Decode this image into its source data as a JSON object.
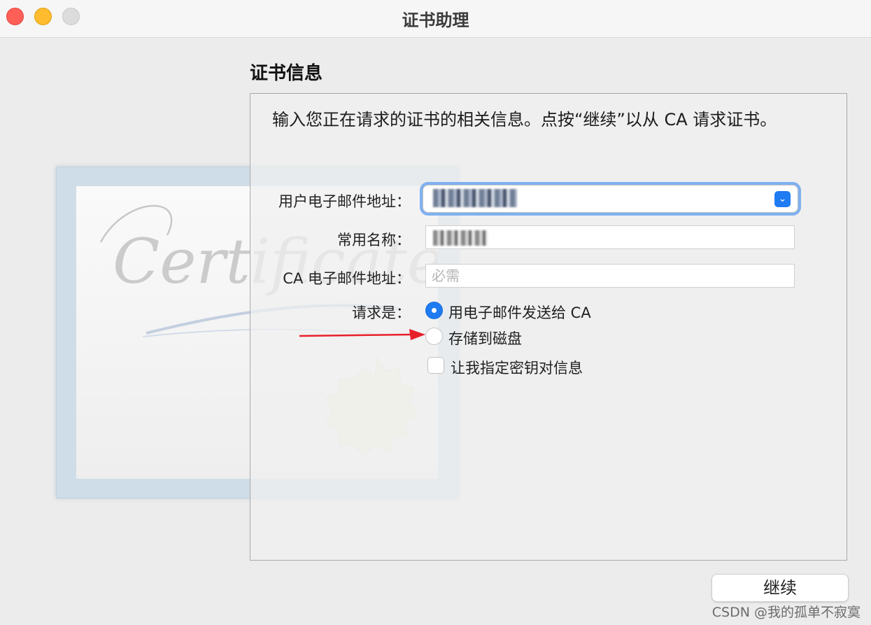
{
  "window": {
    "title": "证书助理"
  },
  "section": {
    "title": "证书信息"
  },
  "description": "输入您正在请求的证书的相关信息。点按“继续”以从 CA 请求证书。",
  "illustration": {
    "script_text": "Certificate"
  },
  "form": {
    "email_label": "用户电子邮件地址：",
    "email_value": "",
    "common_name_label": "常用名称：",
    "common_name_value": "",
    "ca_email_label": "CA 电子邮件地址：",
    "ca_email_placeholder": "必需",
    "request_label": "请求是：",
    "options": [
      {
        "label": "用电子邮件发送给 CA",
        "selected": true
      },
      {
        "label": "存储到磁盘",
        "selected": false
      }
    ],
    "checkbox_label": "让我指定密钥对信息",
    "checkbox_checked": false
  },
  "buttons": {
    "continue_label": "继续"
  },
  "watermark": "CSDN @我的孤单不寂寞",
  "colors": {
    "accent": "#1f7bf2",
    "focus_ring": "#7fb1f0",
    "annotation_arrow": "#e8202a"
  }
}
